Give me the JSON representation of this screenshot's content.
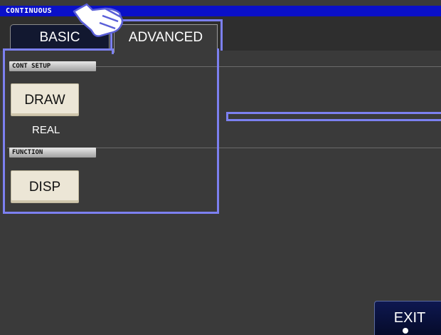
{
  "window": {
    "title": "CONTINUOUS"
  },
  "tabs": [
    {
      "label": "BASIC",
      "active": false
    },
    {
      "label": "ADVANCED",
      "active": true
    }
  ],
  "cont_setup": {
    "header": "CONT SETUP",
    "button_label": "DRAW",
    "value": "REAL"
  },
  "function": {
    "header": "FUNCTION",
    "button_label": "DISP"
  },
  "footer": {
    "exit_label": "EXIT"
  },
  "colors": {
    "title_bar": "#0a10c8",
    "highlight": "#7c80f0",
    "button_face": "#ece6d6",
    "background": "#3a3a3a"
  },
  "icons": {
    "pointer": "pointing-hand-icon"
  }
}
